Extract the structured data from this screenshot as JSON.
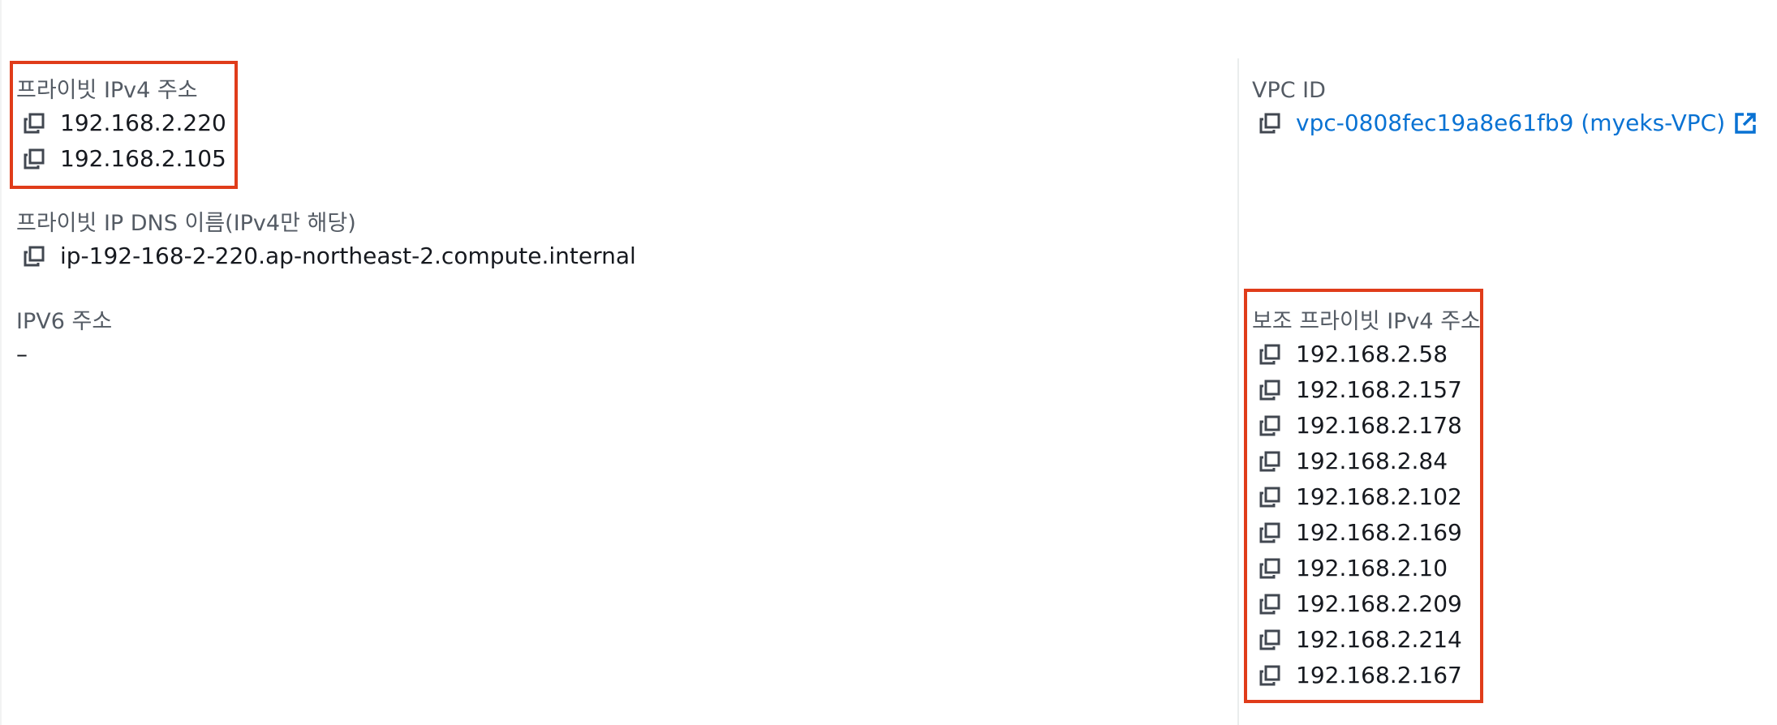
{
  "colors": {
    "label": "#545b64",
    "value": "#16191f",
    "link": "#0972d3",
    "highlight": "#e03c1a",
    "divider": "#eaeded"
  },
  "icons": {
    "copy": "copy-icon",
    "external_link": "external-link-icon"
  },
  "left_column": {
    "private_ipv4": {
      "label": "프라이빗 IPv4 주소",
      "values": [
        "192.168.2.220",
        "192.168.2.105"
      ]
    },
    "private_dns": {
      "label": "프라이빗 IP DNS 이름(IPv4만 해당)",
      "value": "ip-192-168-2-220.ap-northeast-2.compute.internal"
    },
    "ipv6": {
      "label": "IPV6 주소",
      "value": "–"
    }
  },
  "right_column": {
    "vpc_id": {
      "label": "VPC ID",
      "value": "vpc-0808fec19a8e61fb9 (myeks-VPC)"
    },
    "secondary_private_ipv4": {
      "label": "보조 프라이빗 IPv4 주소",
      "values": [
        "192.168.2.58",
        "192.168.2.157",
        "192.168.2.178",
        "192.168.2.84",
        "192.168.2.102",
        "192.168.2.169",
        "192.168.2.10",
        "192.168.2.209",
        "192.168.2.214",
        "192.168.2.167"
      ]
    }
  }
}
